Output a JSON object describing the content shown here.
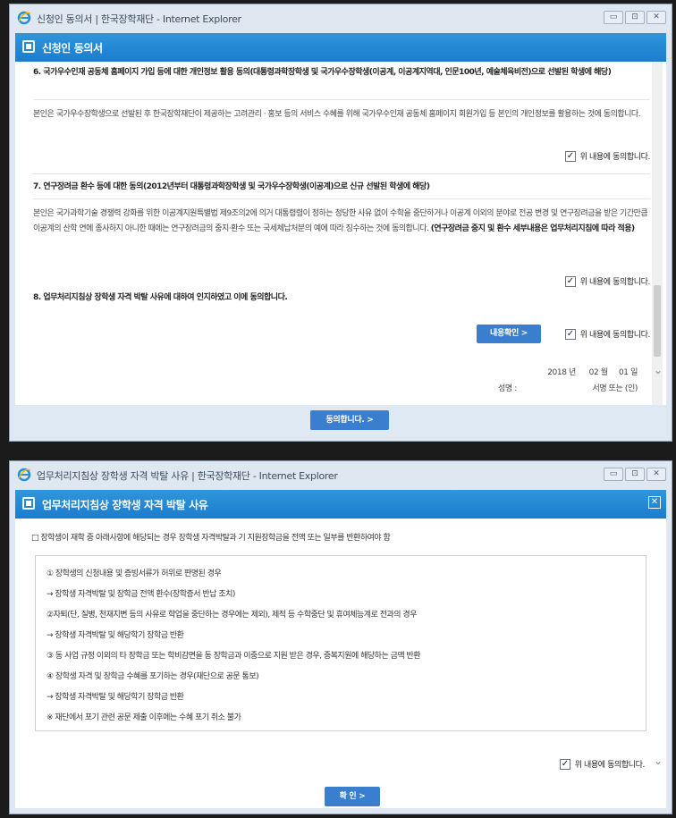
{
  "window1": {
    "title": "신청인 동의서 | 한국장학재단 - Internet Explorer",
    "header_title": "신청인 동의서",
    "section6": {
      "title": "6. 국가우수인재 공동체 홈페이지 가입 등에 대한 개인정보 활용 동의(대통령과학장학생 및 국가우수장학생(이공계, 이공계지역대, 인문100년, 예술체육비전)으로 선발된 학생에 해당)",
      "body": "본인은 국가우수장학생으로 선발된 후 한국장학재단이 제공하는 고려관리 · 홍보 등의 서비스 수혜를 위해 국가우수인재 공동체 홈페이지 회원가입 등 본인의 개인정보를 활용하는 것에 동의합니다.",
      "agree": "위 내용에 동의합니다."
    },
    "section7": {
      "title": "7. 연구장려금 환수 등에 대한 동의(2012년부터 대통령과학장학생 및 국가우수장학생(이공계)으로 신규 선발된 학생에 해당)",
      "body": "본인은 국가과학기술 경쟁력 강화를 위한 이공계지원특별법 제9조의2에 의거 대통령령이 정하는 정당한 사유 없이 수학을 중단하거나 이공계 이외의 분야로 전공 변경 및 연구장려금을 받은 기간만큼 이공계의 산학 연에 종사하지 아니한 때에는 연구장려금의 중지·환수 또는 국세체납처분의 예에 따라 징수하는 것에 동의합니다.",
      "body_bold": "(연구장려금 중지 및 환수 세부내용은 업무처리지침에 따라 적용)",
      "agree": "위 내용에 동의합니다."
    },
    "section8": {
      "title": "8. 업무처리지침상 장학생 자격 박탈 사유에 대하여 인지하였고 이에 동의합니다.",
      "confirm_button": "내용확인 >",
      "agree": "위 내용에 동의합니다."
    },
    "sign": {
      "year": "2018",
      "year_unit": "년",
      "month": "02",
      "month_unit": "월",
      "day": "01",
      "day_unit": "일",
      "name_label": "성명 :",
      "seal_label": "서명 또는 (인)"
    },
    "submit_button": "동의합니다. >"
  },
  "window2": {
    "title": "업무처리지침상 장학생 자격 박탈 사유 | 한국장학재단 - Internet Explorer",
    "header_title": "업무처리지침상 장학생 자격 박탈 사유",
    "notice": "□ 장학생이 재학 중 아래사항에 해당되는 경우 장학생 자격박탈과 기 지원장학금을 전액 또는 일부를 반환하여야 함",
    "lines": [
      "① 장학생의 신청내용 및 증빙서류가 허위로 판명된 경우",
      "→ 장학생 자격박탈 및 장학금 전액 환수(장학증서 반납 조치)",
      "②자퇴(단, 질병, 천재지변 등의 사유로 학업을 중단하는 경우에는 제외), 제적 등 수학중단 및 휴여체능계로 전과의 경우",
      "→ 장학생 자격박탈 및 해당학기 장학금 반환",
      "③ 동 사업 규정 이외의 타 장학금 또는 학비감면을 동 장학금과 이중으로 지원 받은 경우, 중복지원에 해당하는 금액 반환",
      "④ 장학생 자격 및 장학금 수혜를 포기하는 경우(재단으로 공문 통보)",
      "→ 장학생 자격박탈 및 해당학기 장학금 반환",
      "※ 재단에서 포기 관련 공문 제출 이후에는 수혜 포기 취소 불가"
    ],
    "agree": "위 내용에 동의합니다.",
    "ok_button": "확 인 >"
  },
  "colors": {
    "header_blue": "#1f86d3",
    "button_blue": "#3a7fcf"
  }
}
